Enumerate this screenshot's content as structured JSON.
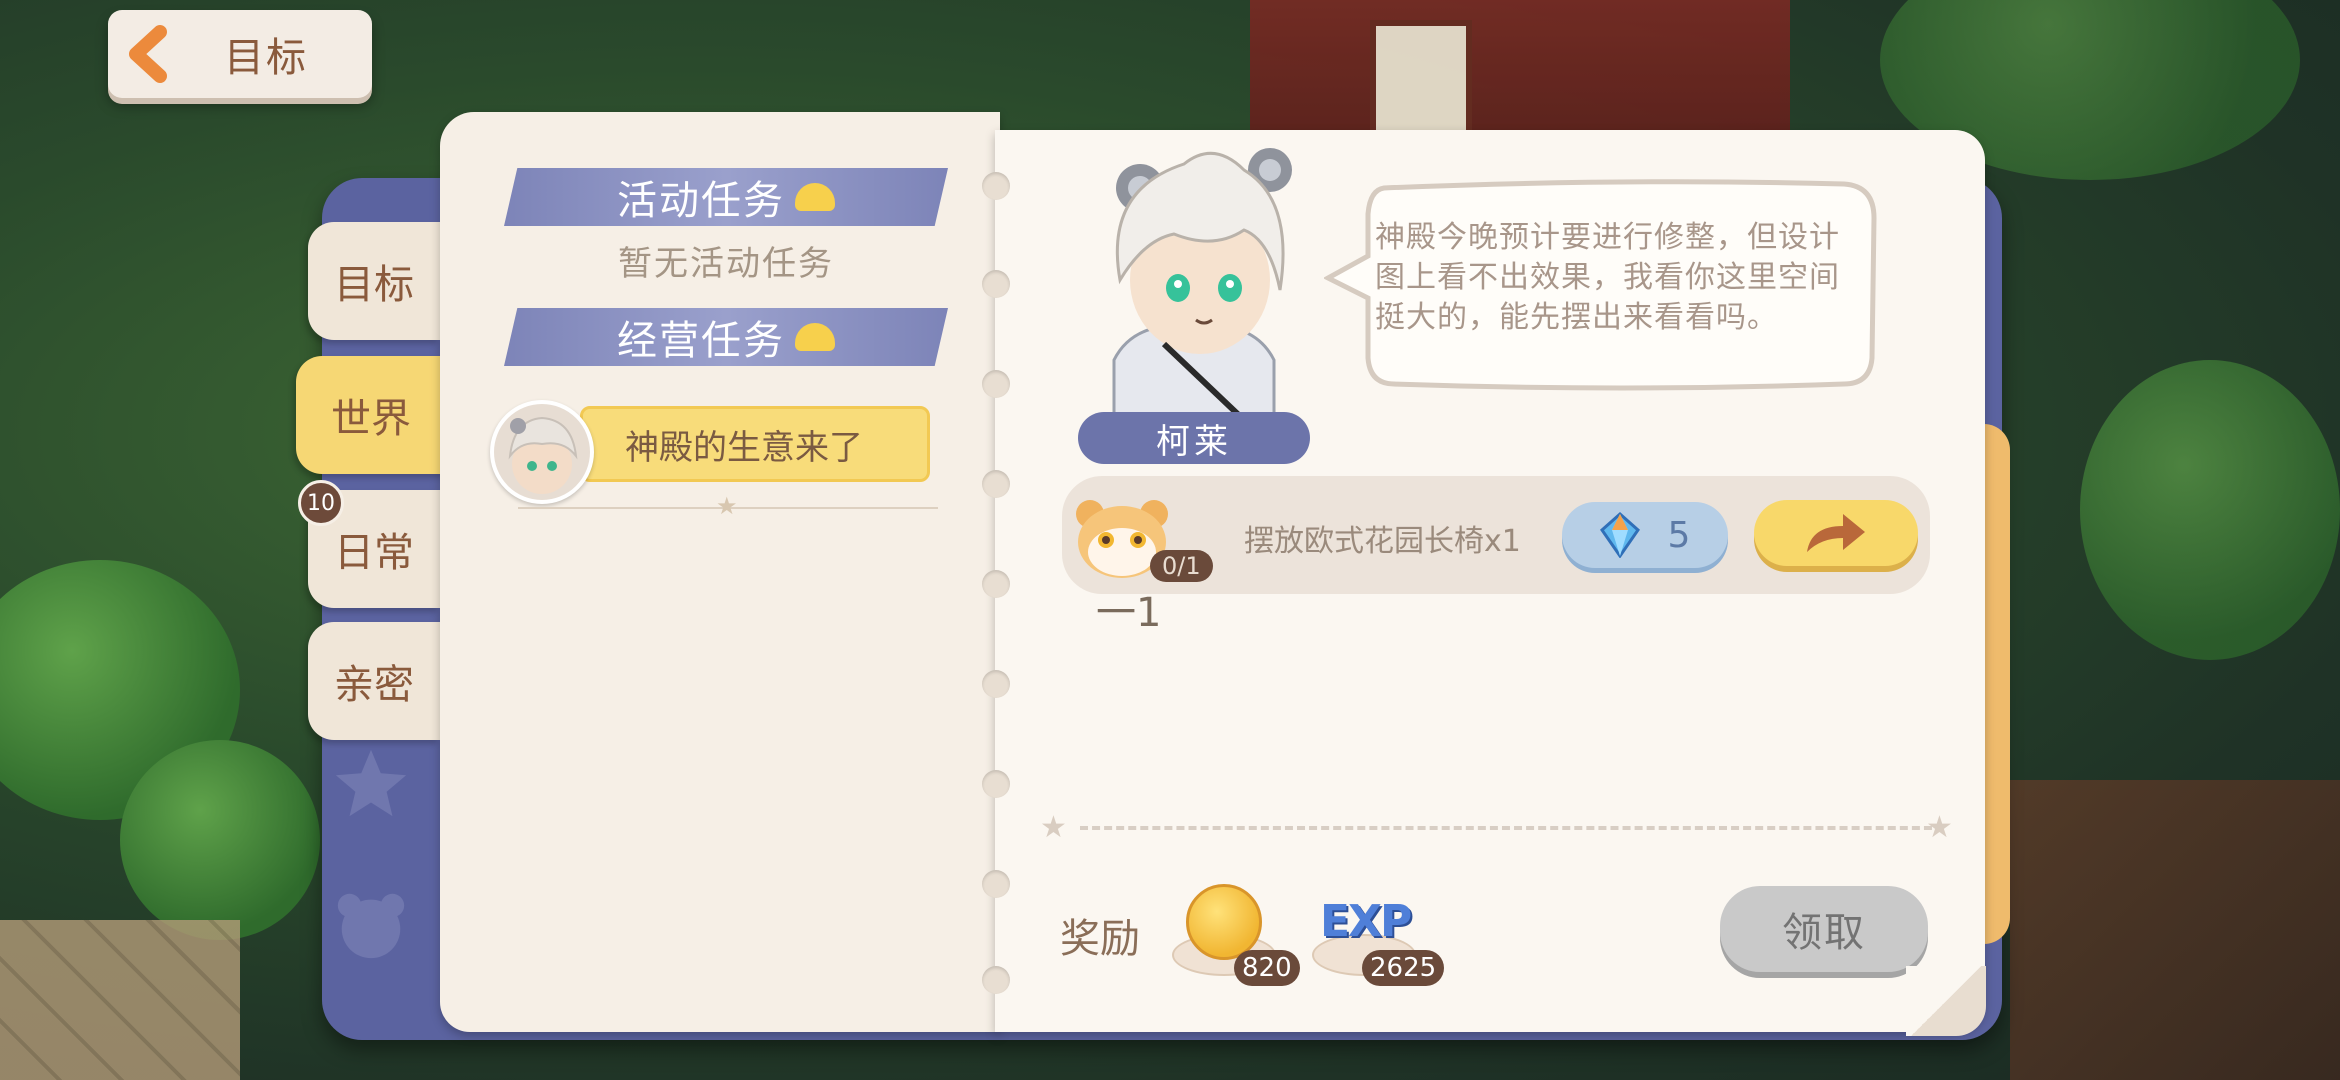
{
  "header": {
    "back_label": "目标"
  },
  "side_tabs": [
    {
      "label": "目标"
    },
    {
      "label": "世界"
    },
    {
      "label": "日常",
      "badge": "10"
    },
    {
      "label": "亲密"
    }
  ],
  "left_page": {
    "activity_title": "活动任务",
    "activity_empty": "暂无活动任务",
    "business_title": "经营任务",
    "quest_item": "神殿的生意来了"
  },
  "character": {
    "name": "柯莱",
    "speech": "神殿今晚预计要进行修整，但设计图上看不出效果，我看你这里空间挺大的，能先摆出来看看吗。"
  },
  "task": {
    "progress": "0/1",
    "sub": "一1",
    "description": "摆放欧式花园长椅x1",
    "gem_cost": "5"
  },
  "rewards": {
    "label": "奖励",
    "coin_amount": "820",
    "exp_label": "EXP",
    "exp_amount": "2625",
    "claim_label": "领取"
  },
  "colors": {
    "accent_blue": "#6c74aa",
    "accent_yellow": "#f8d86a",
    "paper": "#fbf7f1"
  }
}
